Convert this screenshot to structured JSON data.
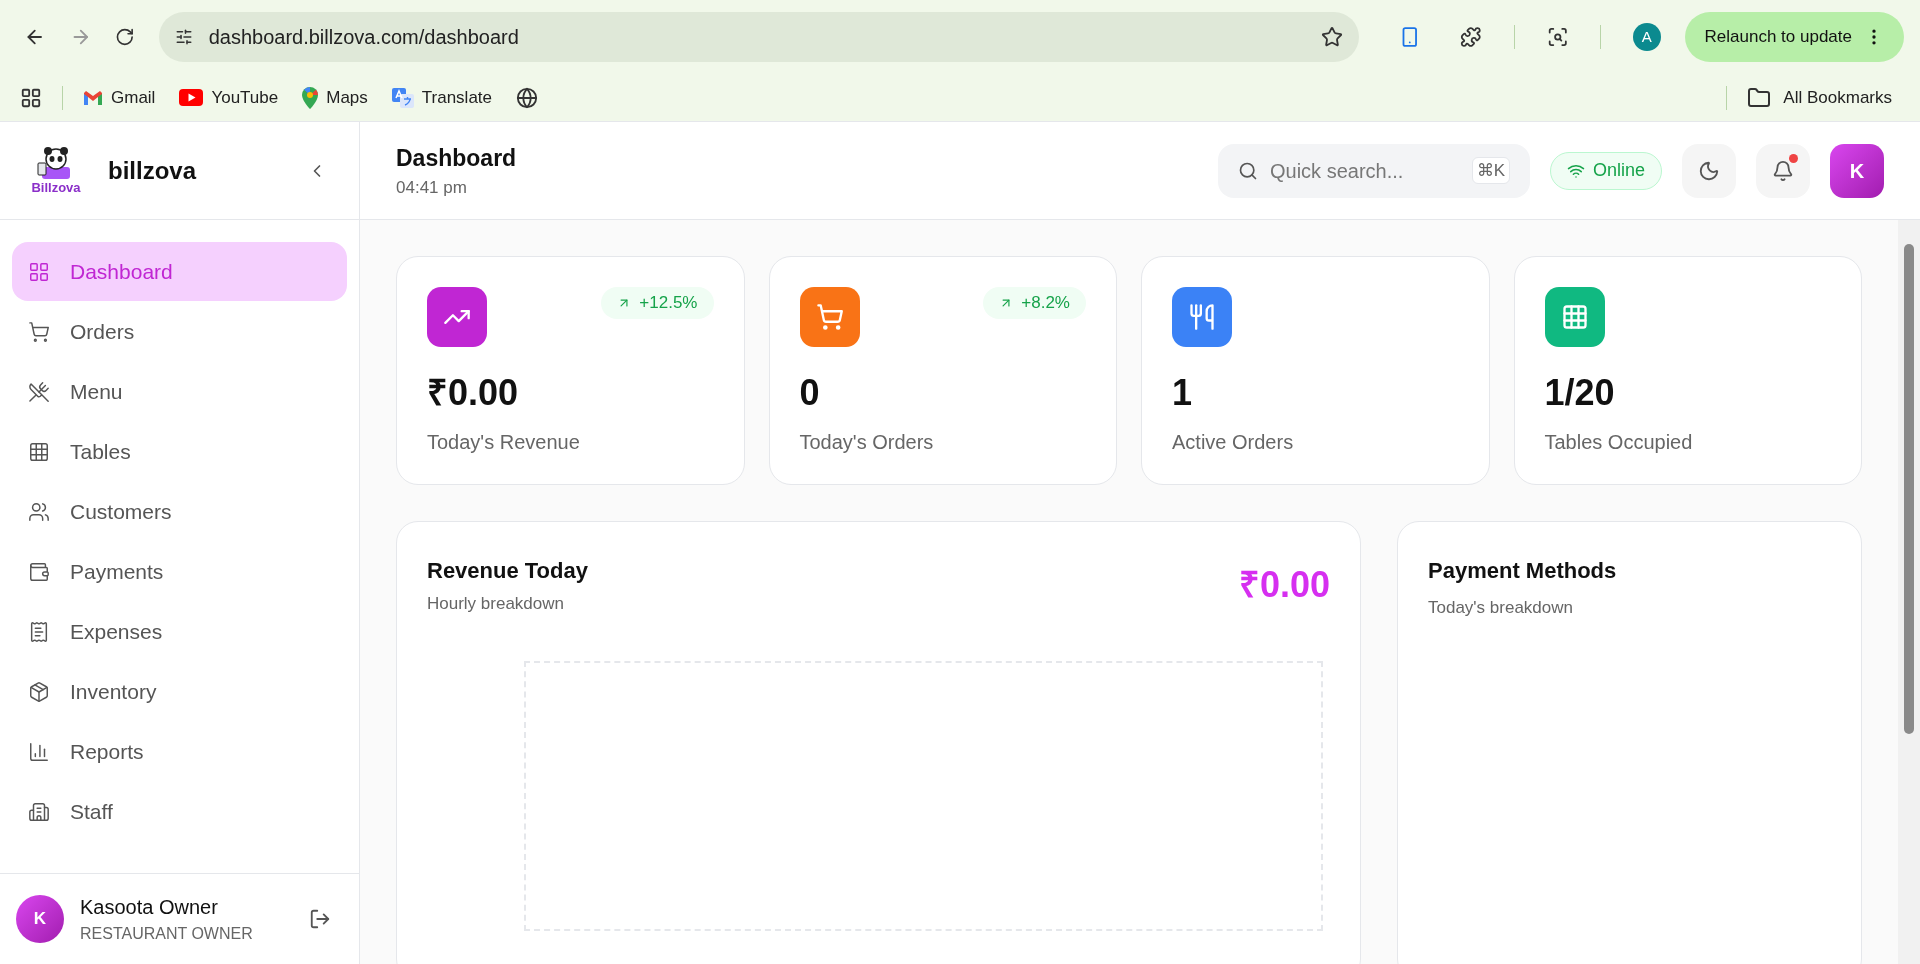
{
  "browser": {
    "url": "dashboard.billzova.com/dashboard",
    "profile_initial": "A",
    "relaunch": "Relaunch to update",
    "bookmarks": [
      {
        "kind": "gmail",
        "label": "Gmail"
      },
      {
        "kind": "youtube",
        "label": "YouTube"
      },
      {
        "kind": "maps",
        "label": "Maps"
      },
      {
        "kind": "translate",
        "label": "Translate"
      }
    ],
    "all_bookmarks": "All Bookmarks"
  },
  "sidebar": {
    "logo_text": "Billzova",
    "brand": "billzova",
    "items": [
      {
        "label": "Dashboard",
        "selected": true
      },
      {
        "label": "Orders",
        "selected": false
      },
      {
        "label": "Menu",
        "selected": false
      },
      {
        "label": "Tables",
        "selected": false
      },
      {
        "label": "Customers",
        "selected": false
      },
      {
        "label": "Payments",
        "selected": false
      },
      {
        "label": "Expenses",
        "selected": false
      },
      {
        "label": "Inventory",
        "selected": false
      },
      {
        "label": "Reports",
        "selected": false
      },
      {
        "label": "Staff",
        "selected": false
      }
    ],
    "user": {
      "initial": "K",
      "name": "Kasoota Owner",
      "role": "RESTAURANT OWNER"
    }
  },
  "header": {
    "title": "Dashboard",
    "time": "04:41 pm",
    "search_placeholder": "Quick search...",
    "shortcut": "⌘K",
    "status": "Online",
    "unread": true,
    "avatar": "K"
  },
  "stats": [
    {
      "color": "#c026d3",
      "value": "₹0.00",
      "label": "Today's Revenue",
      "trend": "+12.5%"
    },
    {
      "color": "#f97316",
      "value": "0",
      "label": "Today's Orders",
      "trend": "+8.2%"
    },
    {
      "color": "#3b82f6",
      "value": "1",
      "label": "Active Orders"
    },
    {
      "color": "#10b981",
      "value": "1/20",
      "label": "Tables Occupied"
    }
  ],
  "revenue": {
    "title": "Revenue Today",
    "subtitle": "Hourly breakdown",
    "total": "₹0.00"
  },
  "payments": {
    "title": "Payment Methods",
    "subtitle": "Today's breakdown"
  }
}
